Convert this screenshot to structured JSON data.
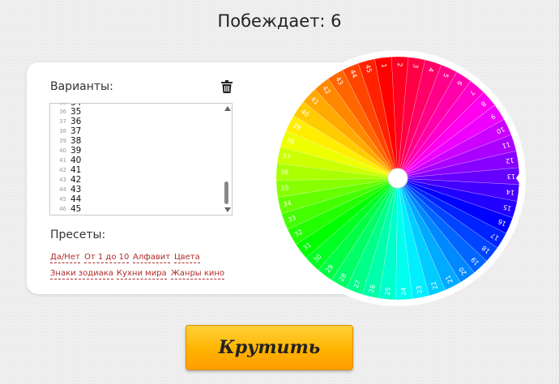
{
  "header": {
    "winner_text": "Побеждает: 6"
  },
  "options": {
    "label": "Варианты:",
    "clear_icon": "trash-icon",
    "lines": [
      {
        "n": "36",
        "v": "35"
      },
      {
        "n": "37",
        "v": "36"
      },
      {
        "n": "38",
        "v": "37"
      },
      {
        "n": "39",
        "v": "38"
      },
      {
        "n": "40",
        "v": "39"
      },
      {
        "n": "41",
        "v": "40"
      },
      {
        "n": "42",
        "v": "41"
      },
      {
        "n": "43",
        "v": "42"
      },
      {
        "n": "44",
        "v": "43"
      },
      {
        "n": "45",
        "v": "44"
      },
      {
        "n": "46",
        "v": "45"
      }
    ]
  },
  "presets": {
    "label": "Пресеты:",
    "items": [
      "Да/Нет",
      "От 1 до 10",
      "Алфавит",
      "Цвета",
      "Знаки зодиака",
      "Кухни мира",
      "Жанры кино"
    ]
  },
  "wheel": {
    "segments": [
      "1",
      "2",
      "3",
      "4",
      "5",
      "6",
      "7",
      "8",
      "9",
      "10",
      "11",
      "12",
      "13",
      "14",
      "15",
      "16",
      "17",
      "18",
      "19",
      "20",
      "21",
      "22",
      "23",
      "24",
      "25",
      "26",
      "27",
      "28",
      "29",
      "30",
      "31",
      "32",
      "33",
      "34",
      "35",
      "36",
      "37",
      "38",
      "39",
      "40",
      "41",
      "42",
      "43",
      "44",
      "45"
    ]
  },
  "spin_button": {
    "label": "Крутить"
  },
  "colors": {
    "accent": "#ffb300",
    "preset_link": "#b02a2a"
  }
}
